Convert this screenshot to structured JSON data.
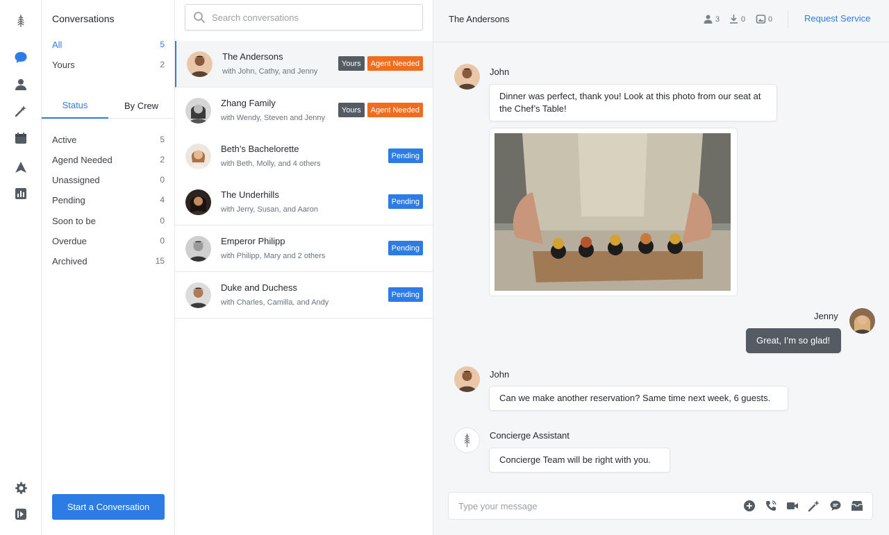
{
  "nav": {
    "icons": [
      "leaf-logo",
      "chat-icon",
      "person-icon",
      "wand-icon",
      "calendar-icon",
      "navigation-icon",
      "chart-icon",
      "gear-icon",
      "collapse-icon"
    ],
    "active_color": "#2d7be5"
  },
  "filters": {
    "heading": "Conversations",
    "scopes": [
      {
        "label": "All",
        "count": "5"
      },
      {
        "label": "Yours",
        "count": "2"
      }
    ],
    "tabs": [
      "Status",
      "By Crew"
    ],
    "statuses": [
      {
        "label": "Active",
        "count": "5"
      },
      {
        "label": "Agend Needed",
        "count": "2"
      },
      {
        "label": "Unassigned",
        "count": "0"
      },
      {
        "label": "Pending",
        "count": "4"
      },
      {
        "label": "Soon to be",
        "count": "0"
      },
      {
        "label": "Overdue",
        "count": "0"
      },
      {
        "label": "Archived",
        "count": "15"
      }
    ],
    "start_button": "Start a Conversation"
  },
  "search": {
    "placeholder": "Search conversations"
  },
  "conversations": [
    {
      "name": "The Andersons",
      "sub": "with John, Cathy, and Jenny",
      "badges": [
        "Yours",
        "Agent Needed"
      ]
    },
    {
      "name": "Zhang Family",
      "sub": "with Wendy, Steven and Jenny",
      "badges": [
        "Yours",
        "Agent Needed"
      ]
    },
    {
      "name": "Beth’s Bachelorette",
      "sub": "with Beth, Molly, and 4 others",
      "badges": [
        "Pending"
      ]
    },
    {
      "name": "The Underhills",
      "sub": "with Jerry, Susan, and Aaron",
      "badges": [
        "Pending"
      ]
    },
    {
      "name": "Emperor Philipp",
      "sub": "with Philipp, Mary and 2 others",
      "badges": [
        "Pending"
      ]
    },
    {
      "name": "Duke and Duchess",
      "sub": "with Charles, Camilla, and Andy",
      "badges": [
        "Pending"
      ]
    }
  ],
  "chat": {
    "title": "The Andersons",
    "stats": {
      "members": "3",
      "downloads": "0",
      "photos": "0"
    },
    "request_button": "Request Service",
    "messages": [
      {
        "sender": "John",
        "text": "Dinner was perfect, thank you! Look at this photo from our seat at the Chef’s Table!"
      },
      {
        "sender": "Jenny",
        "text": "Great, I’m so glad!"
      },
      {
        "sender": "John",
        "text": "Can we make another reservation? Same time next week, 6 guests."
      },
      {
        "sender": "Concierge Assistant",
        "text": "Concierge Team will be right with you."
      }
    ],
    "composer_placeholder": "Type your message"
  }
}
